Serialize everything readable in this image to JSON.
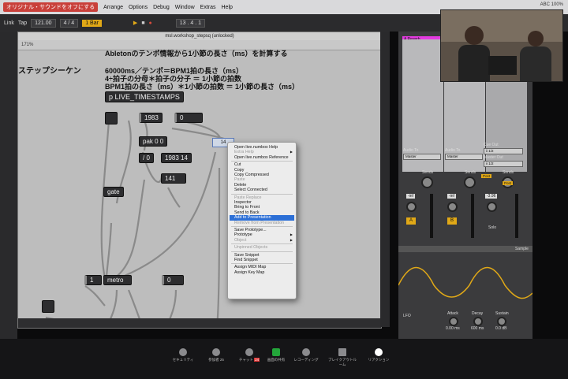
{
  "menubar": {
    "app_menu": "オリジナル・サウンドをオフにする",
    "items": [
      "Arrange",
      "Options",
      "Debug",
      "Window",
      "Extras",
      "Help"
    ],
    "status": "ABC 100%"
  },
  "transport": {
    "link": "Link",
    "tap": "Tap",
    "tempo": "121.00",
    "signature": "4 / 4",
    "quantize": "1 Bar",
    "position": "13 . 4 . 1"
  },
  "max": {
    "window_title": "msl.workshop_stepsq (unlocked)",
    "zoom": "171%",
    "heading": "ステップシーケン",
    "comments": {
      "top": "Abletonのテンポ情報から1小節の長さ（ms）を計算する",
      "line1": "60000ms／テンポ＝BPM1拍の長さ（ms）",
      "line2": "4÷拍子の分母＊拍子の分子 ＝ 1小節の拍数",
      "line3": "BPM1拍の長さ（ms）＊1小節の拍数 ＝ 1小節の長さ（ms）"
    },
    "objects": {
      "timestamps": "p LIVE_TIMESTAMPS",
      "num1983": "1983",
      "num0a": "0",
      "pak": "pak 0 0",
      "div": "/ 0",
      "list": "1983 14",
      "num141": "141",
      "gate": "gate",
      "num1": "1",
      "metro": "metro",
      "num0b": "0",
      "numbox14": "14"
    },
    "context_menu": [
      {
        "label": "Open live.numbox Help",
        "state": "normal"
      },
      {
        "label": "Extra Help",
        "state": "disabled",
        "arrow": true
      },
      {
        "label": "Open live.numbox Reference",
        "state": "normal"
      },
      {
        "sep": true
      },
      {
        "label": "Cut",
        "state": "normal"
      },
      {
        "label": "Copy",
        "state": "normal"
      },
      {
        "label": "Copy Compressed",
        "state": "normal"
      },
      {
        "label": "Paste",
        "state": "disabled"
      },
      {
        "label": "Delete",
        "state": "normal"
      },
      {
        "label": "Select Connected",
        "state": "normal"
      },
      {
        "sep": true
      },
      {
        "label": "Paste Replace",
        "state": "disabled"
      },
      {
        "label": "Inspector",
        "state": "normal"
      },
      {
        "label": "Bring to Front",
        "state": "normal"
      },
      {
        "label": "Send to Back",
        "state": "normal"
      },
      {
        "label": "Add to Presentation",
        "state": "highlighted"
      },
      {
        "label": "Remove from Presentation",
        "state": "disabled"
      },
      {
        "sep": true
      },
      {
        "label": "Save Prototype...",
        "state": "normal"
      },
      {
        "label": "Prototype",
        "state": "normal",
        "arrow": true
      },
      {
        "label": "Object",
        "state": "disabled",
        "arrow": true
      },
      {
        "sep": true
      },
      {
        "label": "Unpinned Objects",
        "state": "disabled"
      },
      {
        "sep": true
      },
      {
        "label": "Save Snippet",
        "state": "normal"
      },
      {
        "label": "Find Snippet",
        "state": "normal"
      },
      {
        "sep": true
      },
      {
        "label": "Assign MIDI Map",
        "state": "normal"
      },
      {
        "label": "Assign Key Map",
        "state": "normal"
      }
    ]
  },
  "mixer": {
    "track_name": "A Reverb",
    "audio_to": "Audio To",
    "master": "Master",
    "cue_out": "Cue Out",
    "cue_out_value": "ii 1/2",
    "master_out": "Master Out",
    "master_out_value": "ii 1/2",
    "sends": "Sends",
    "post": "Post",
    "inf": "-inf",
    "master_vol": "-3.96",
    "track_a": "A",
    "track_b": "B",
    "solo": "Solo",
    "sample": "Sample",
    "lfo": "LFO",
    "attack": "Attack",
    "attack_val": "0.00 ms",
    "decay": "Decay",
    "decay_val": "600 ms",
    "sustain": "Sustain",
    "sustain_val": "0.0 dB"
  },
  "zoom": {
    "items": [
      "セキュリティ",
      "参加者",
      "チャット",
      "画面の共有",
      "レコーディング",
      "ブレイクアウトルーム",
      "リアクション"
    ],
    "participants_count": "25",
    "chat_badge": "24"
  }
}
